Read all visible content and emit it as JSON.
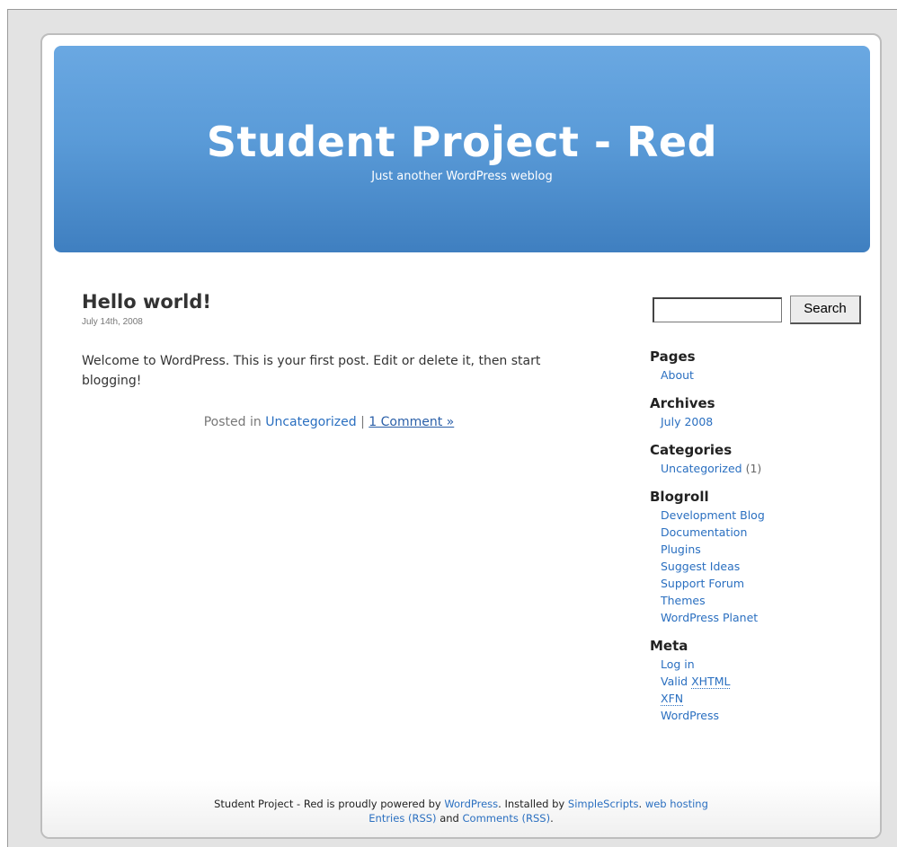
{
  "header": {
    "title": "Student Project - Red",
    "description": "Just another WordPress weblog"
  },
  "post": {
    "title": "Hello world!",
    "date": "July 14th, 2008",
    "body": "Welcome to WordPress. This is your first post. Edit or delete it, then start blogging!",
    "posted_in_prefix": "Posted in",
    "category_link": "Uncategorized",
    "separator": "|",
    "comments_link": "1 Comment »"
  },
  "sidebar": {
    "search": {
      "value": "",
      "button_label": "Search"
    },
    "pages": {
      "heading": "Pages",
      "items": [
        "About"
      ]
    },
    "archives": {
      "heading": "Archives",
      "items": [
        "July 2008"
      ]
    },
    "categories": {
      "heading": "Categories",
      "items": [
        {
          "label": "Uncategorized",
          "count": "(1)"
        }
      ]
    },
    "blogroll": {
      "heading": "Blogroll",
      "items": [
        "Development Blog",
        "Documentation",
        "Plugins",
        "Suggest Ideas",
        "Support Forum",
        "Themes",
        "WordPress Planet"
      ]
    },
    "meta": {
      "heading": "Meta",
      "log_in": "Log in",
      "valid_prefix": "Valid",
      "xhtml": "XHTML",
      "xfn": "XFN",
      "wordpress": "WordPress"
    }
  },
  "footer": {
    "line1_prefix": "Student Project - Red is proudly powered by",
    "wordpress_link": "WordPress",
    "installed_by": ". Installed by",
    "simplescripts_link": "SimpleScripts",
    "web_hosting_link": "web hosting",
    "entries_rss": "Entries (RSS)",
    "and_text": "and",
    "comments_rss": "Comments (RSS)",
    "period": "."
  },
  "colors": {
    "header_top": "#6aa8e2",
    "header_bottom": "#3f7fc0",
    "link": "#2a6fc0"
  }
}
